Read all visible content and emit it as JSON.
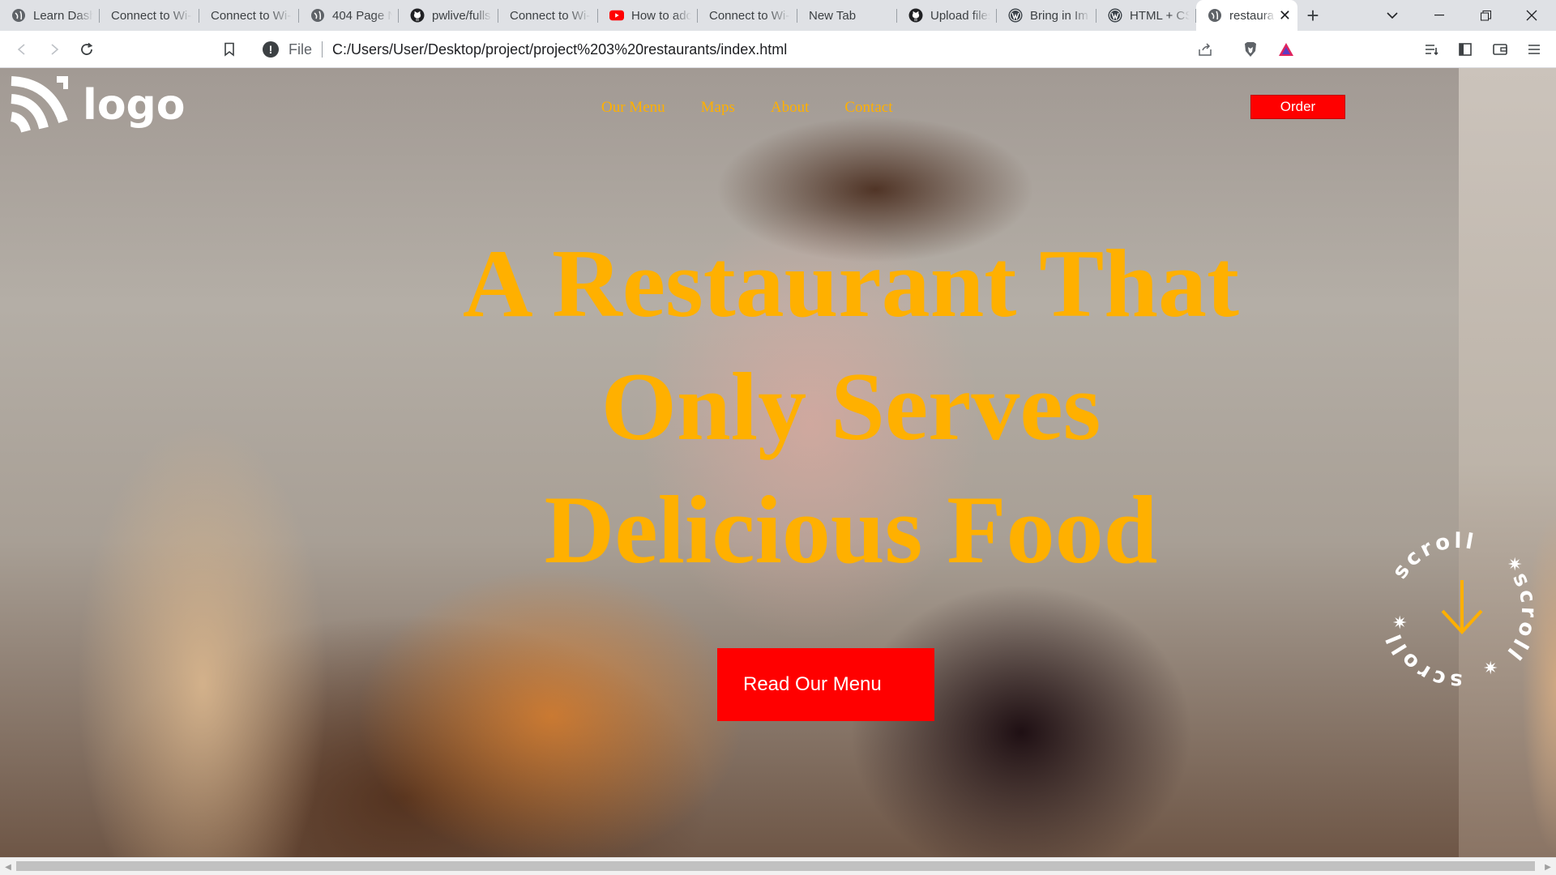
{
  "browser": {
    "tabs": [
      {
        "title": "Learn Dashi",
        "icon": "globe-icon"
      },
      {
        "title": "Connect to Wi-F",
        "icon": "none"
      },
      {
        "title": "Connect to Wi-F",
        "icon": "none"
      },
      {
        "title": "404 Page N",
        "icon": "globe-icon"
      },
      {
        "title": "pwlive/fulls",
        "icon": "github-icon"
      },
      {
        "title": "Connect to Wi-F",
        "icon": "none"
      },
      {
        "title": "How to adc",
        "icon": "youtube-icon"
      },
      {
        "title": "Connect to Wi-F",
        "icon": "none"
      },
      {
        "title": "New Tab",
        "icon": "none"
      },
      {
        "title": "Upload files",
        "icon": "github-icon"
      },
      {
        "title": "Bring in Im",
        "icon": "wordpress-icon"
      },
      {
        "title": "HTML + CS",
        "icon": "wordpress-icon"
      },
      {
        "title": "restaura",
        "icon": "globe-icon",
        "active": true
      }
    ],
    "address": {
      "scheme_label": "File",
      "url": "C:/Users/User/Desktop/project/project%203%20restaurants/index.html"
    }
  },
  "page": {
    "logo_text": "logo",
    "nav": [
      "Our Menu",
      "Maps",
      "About",
      "Contact"
    ],
    "order_button": "Order",
    "headline": [
      "A Restaurant That",
      "Only Serves",
      "Delicious Food"
    ],
    "menu_button": "Read Our Menu",
    "scroll_badge_text": "scroll",
    "colors": {
      "accent_yellow": "#ffb000",
      "button_red": "#ff0000"
    }
  }
}
